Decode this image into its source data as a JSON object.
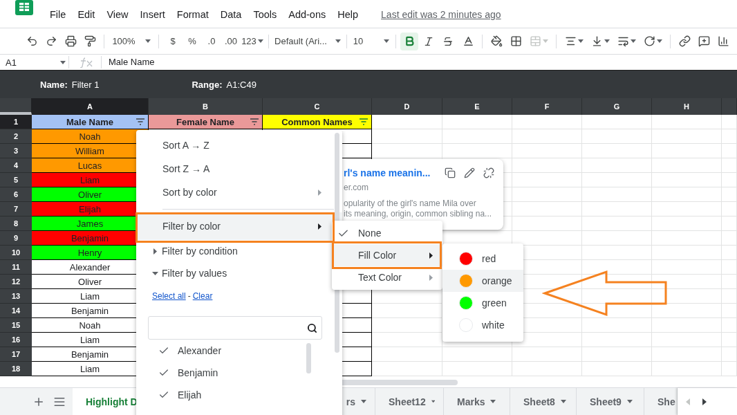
{
  "menu_bar": [
    "File",
    "Edit",
    "View",
    "Insert",
    "Format",
    "Data",
    "Tools",
    "Add-ons",
    "Help"
  ],
  "last_edit": "Last edit was 2 minutes ago",
  "toolbar": {
    "zoom": "100%",
    "currency": "$",
    "percent": "%",
    "decrease_decimals": ".0",
    "increase_decimals": ".00",
    "more_formats": "123",
    "font": "Default (Ari...",
    "font_size": "10",
    "format_buttons": [
      {
        "kind": "bold",
        "active": true
      },
      {
        "kind": "italic",
        "active": false
      },
      {
        "kind": "strikethrough",
        "active": false
      }
    ],
    "merge": {
      "disabled": true
    }
  },
  "formula_bar": {
    "cell_ref": "A1",
    "value": "Male Name"
  },
  "filter_bar": {
    "name_label": "Name:",
    "name": "Filter 1",
    "range_label": "Range:",
    "range": "A1:C49"
  },
  "columns": [
    {
      "label": "A",
      "selected": true
    },
    {
      "label": "B",
      "selected": false
    },
    {
      "label": "C",
      "selected": false
    },
    {
      "label": "D",
      "selected": false
    },
    {
      "label": "E",
      "selected": false
    },
    {
      "label": "F",
      "selected": false
    },
    {
      "label": "G",
      "selected": false
    },
    {
      "label": "H",
      "selected": false
    }
  ],
  "rows": [
    {
      "number": "1",
      "selected": true,
      "kind": "header",
      "cells": [
        {
          "text": "Male Name",
          "color": "#a4c2f4"
        },
        {
          "text": "Female Name",
          "color": "#ea9999"
        },
        {
          "text": "Common Names",
          "color": "#ffff00"
        }
      ]
    },
    {
      "number": "2",
      "selected": false,
      "kind": "data",
      "cells": [
        {
          "text": "Noah",
          "color": "#ff9900"
        }
      ]
    },
    {
      "number": "3",
      "selected": false,
      "kind": "data",
      "cells": [
        {
          "text": "William",
          "color": "#ff9900"
        }
      ]
    },
    {
      "number": "4",
      "selected": false,
      "kind": "data",
      "cells": [
        {
          "text": "Lucas",
          "color": "#ff9900"
        }
      ]
    },
    {
      "number": "5",
      "selected": false,
      "kind": "data",
      "cells": [
        {
          "text": "Liam",
          "color": "#ff0000"
        }
      ]
    },
    {
      "number": "6",
      "selected": false,
      "kind": "data",
      "cells": [
        {
          "text": "Oliver",
          "color": "#00ff00"
        }
      ]
    },
    {
      "number": "7",
      "selected": false,
      "kind": "data",
      "cells": [
        {
          "text": "Elijah",
          "color": "#ff0000"
        }
      ]
    },
    {
      "number": "8",
      "selected": false,
      "kind": "data",
      "cells": [
        {
          "text": "James",
          "color": "#00ff00"
        }
      ]
    },
    {
      "number": "9",
      "selected": false,
      "kind": "data",
      "cells": [
        {
          "text": "Benjamin",
          "color": "#ff0000"
        }
      ]
    },
    {
      "number": "10",
      "selected": false,
      "kind": "data",
      "cells": [
        {
          "text": "Henry",
          "color": "#00ff00"
        }
      ]
    },
    {
      "number": "11",
      "selected": false,
      "kind": "data",
      "cells": [
        {
          "text": "Alexander",
          "color": "#ffffff"
        }
      ]
    },
    {
      "number": "12",
      "selected": false,
      "kind": "data",
      "cells": [
        {
          "text": "Oliver",
          "color": "#ffffff"
        }
      ]
    },
    {
      "number": "13",
      "selected": false,
      "kind": "data",
      "cells": [
        {
          "text": "Liam",
          "color": "#ffffff"
        }
      ]
    },
    {
      "number": "14",
      "selected": false,
      "kind": "data",
      "cells": [
        {
          "text": "Benjamin",
          "color": "#ffffff"
        }
      ]
    },
    {
      "number": "15",
      "selected": false,
      "kind": "data",
      "cells": [
        {
          "text": "Noah",
          "color": "#ffffff"
        }
      ]
    },
    {
      "number": "16",
      "selected": false,
      "kind": "data",
      "cells": [
        {
          "text": "Liam",
          "color": "#ffffff"
        }
      ]
    },
    {
      "number": "17",
      "selected": false,
      "kind": "data",
      "cells": [
        {
          "text": "Benjamin",
          "color": "#ffffff"
        }
      ]
    },
    {
      "number": "18",
      "selected": false,
      "kind": "data",
      "cells": [
        {
          "text": "Liam",
          "color": "#ffffff"
        }
      ]
    }
  ],
  "filter_menu": {
    "items": [
      {
        "kind": "action",
        "label": "Sort A → Z",
        "highlighted": false
      },
      {
        "kind": "action",
        "label": "Sort Z → A",
        "highlighted": false
      },
      {
        "kind": "submenu",
        "label": "Sort by color",
        "highlighted": false
      },
      {
        "kind": "divider"
      },
      {
        "kind": "submenu",
        "label": "Filter by color",
        "highlighted": true
      },
      {
        "kind": "section",
        "label": "Filter by condition",
        "expanded": false
      },
      {
        "kind": "section",
        "label": "Filter by values",
        "expanded": true
      }
    ],
    "select_all": "Select all",
    "separator": "-",
    "clear": "Clear",
    "values": [
      {
        "label": "Alexander",
        "checked": true
      },
      {
        "label": "Benjamin",
        "checked": true
      },
      {
        "label": "Elijah",
        "checked": true
      }
    ]
  },
  "link_preview": {
    "title": "rl's name meanin...",
    "domain": "er.com",
    "snippet": [
      "opularity of the girl's name Mila over",
      "its meaning, origin, common sibling na..."
    ]
  },
  "color_submenu": [
    {
      "label": "None",
      "checked": true,
      "has_submenu": false,
      "highlighted": false
    },
    {
      "label": "Fill Color",
      "checked": false,
      "has_submenu": true,
      "highlighted": true
    },
    {
      "label": "Text Color",
      "checked": false,
      "has_submenu": true,
      "highlighted": false
    }
  ],
  "fill_colors": [
    {
      "label": "red",
      "color": "#ff0000",
      "highlighted": false
    },
    {
      "label": "orange",
      "color": "#ff9900",
      "highlighted": true
    },
    {
      "label": "green",
      "color": "#00ff00",
      "highlighted": false
    },
    {
      "label": "white",
      "color": "#ffffff",
      "highlighted": false
    }
  ],
  "sheet_tabs": [
    {
      "label": "Highlight D",
      "selected": true
    },
    {
      "label": "rs",
      "selected": false
    },
    {
      "label": "Sheet12",
      "selected": false
    },
    {
      "label": "Marks",
      "selected": false
    },
    {
      "label": "Sheet8",
      "selected": false
    },
    {
      "label": "Sheet9",
      "selected": false
    },
    {
      "label": "She",
      "selected": false
    }
  ]
}
